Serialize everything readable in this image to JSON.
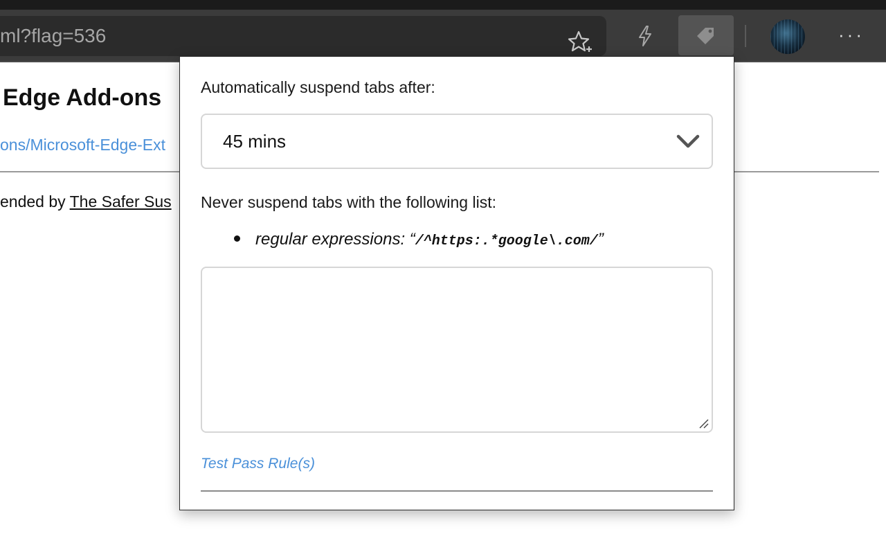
{
  "browser": {
    "url_text": "ml?flag=536",
    "star_icon": "add-favorite-star-icon",
    "bolt_icon": "lightning-bolt-icon",
    "extension_icon": "tag-extension-icon",
    "more_label": "···"
  },
  "page": {
    "title": "Edge Add-ons",
    "link_text": "ons/Microsoft-Edge-Ext",
    "text_prefix": "ended by ",
    "text_underlined": "The Safer Sus"
  },
  "popup": {
    "suspend_label": "Automatically suspend tabs after:",
    "suspend_value": "45 mins",
    "never_label": "Never suspend tabs with the following list:",
    "bullet_prefix": "regular expressions: “",
    "bullet_code": "/^https:.*google\\.com/",
    "bullet_suffix": "”",
    "textarea_value": "",
    "test_link": "Test Pass Rule(s)"
  },
  "colors": {
    "accent_link": "#4a90d9",
    "toolbar": "#3b3b3b"
  }
}
